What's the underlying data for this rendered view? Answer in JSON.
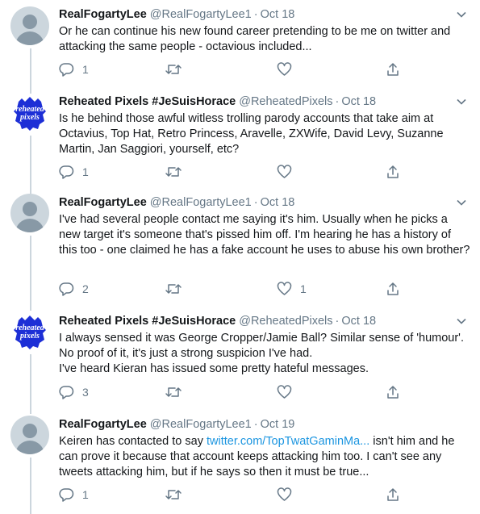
{
  "tweets": [
    {
      "name": "RealFogartyLee",
      "handle": "@RealFogartyLee1",
      "dot": "·",
      "date": "Oct 18",
      "avatar": "default-avatar",
      "text": "Or he can continue his new found career pretending to be me on twitter and attacking the same people - octavious included...",
      "replies": "1",
      "retweets": "",
      "likes": ""
    },
    {
      "name": "Reheated Pixels #JeSuisHorace",
      "handle": "@ReheatedPixels",
      "dot": "·",
      "date": "Oct 18",
      "avatar": "reheated-pixels-logo",
      "avatar_logo_text": [
        "reheated",
        "pixels"
      ],
      "text": "Is he behind those awful witless trolling parody accounts that take aim at Octavius, Top Hat, Retro Princess, Aravelle, ZXWife, David Levy, Suzanne Martin, Jan Saggiori, yourself, etc?",
      "replies": "1",
      "retweets": "",
      "likes": ""
    },
    {
      "name": "RealFogartyLee",
      "handle": "@RealFogartyLee1",
      "dot": "·",
      "date": "Oct 18",
      "avatar": "default-avatar",
      "text": "I've had several people contact me saying it's him. Usually when he picks a new target it's someone that's pissed him off. I'm hearing he has a history of this too - one claimed he has a fake account he uses to abuse his own brother?",
      "replies": "2",
      "retweets": "",
      "likes": "1"
    },
    {
      "name": "Reheated Pixels #JeSuisHorace",
      "handle": "@ReheatedPixels",
      "dot": "·",
      "date": "Oct 18",
      "avatar": "reheated-pixels-logo",
      "avatar_logo_text": [
        "reheated",
        "pixels"
      ],
      "text_lines": [
        "I always sensed it was George Cropper/Jamie Ball? Similar sense of 'humour'.",
        "No proof of it, it's just a strong suspicion I've had.",
        "I've heard Kieran has issued some pretty hateful messages."
      ],
      "replies": "3",
      "retweets": "",
      "likes": ""
    },
    {
      "name": "RealFogartyLee",
      "handle": "@RealFogartyLee1",
      "dot": "·",
      "date": "Oct 19",
      "avatar": "default-avatar",
      "text_before_link": "Keiren has contacted to say ",
      "link": "twitter.com/TopTwatGaminMa...",
      "text_after_link": " isn't him and he can prove it because that account keeps attacking him too. I can't see any tweets attacking him, but if he says so then it must be true...",
      "replies": "1",
      "retweets": "",
      "likes": ""
    }
  ],
  "colors": {
    "name": "#14171a",
    "meta": "#657786",
    "link": "#1b95e0",
    "thread_line": "#ccd6dd",
    "logo_blue": "#1d2fd6"
  },
  "icons": [
    "chevron-down-icon",
    "reply-icon",
    "retweet-icon",
    "like-icon",
    "share-icon"
  ]
}
